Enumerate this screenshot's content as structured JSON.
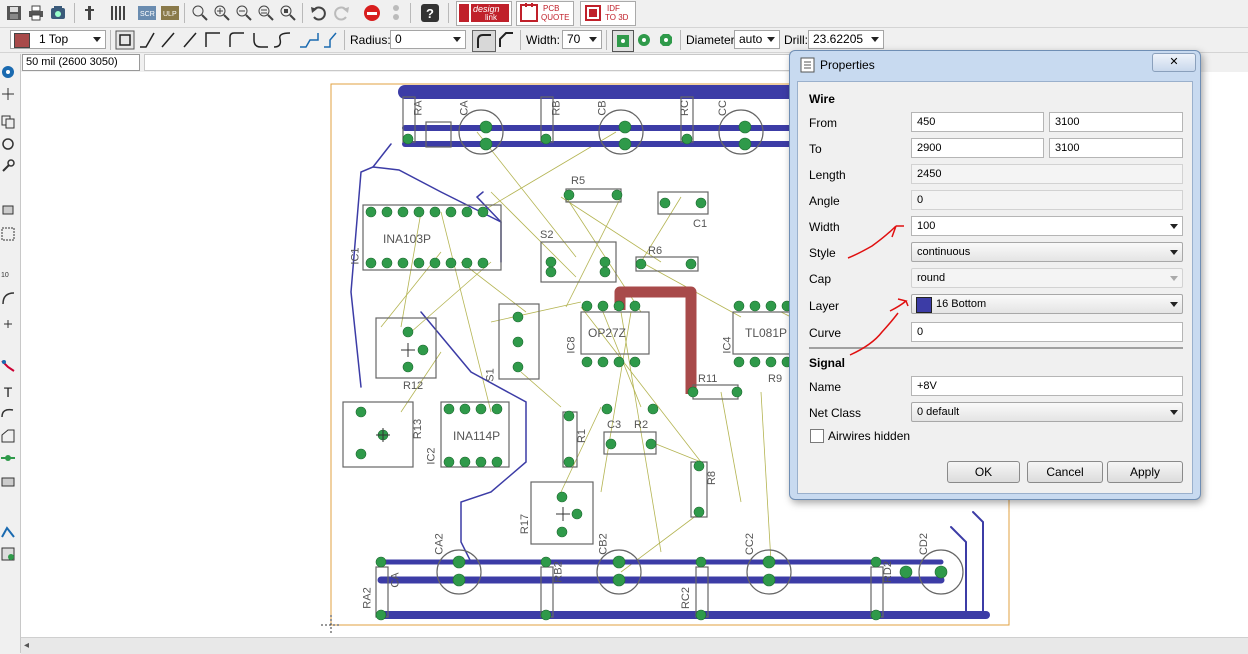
{
  "toolbar": {
    "layer_select": "1 Top",
    "radius_label": "Radius:",
    "radius_value": "0",
    "width_label": "Width:",
    "width_value": "70",
    "diameter_label": "Diameter:",
    "diameter_value": "auto",
    "drill_label": "Drill:",
    "drill_value": "23.62205",
    "design_link": [
      "design",
      "link"
    ],
    "pcb_quote": [
      "PCB",
      "QUOTE"
    ],
    "idf": [
      "IDF",
      "TO 3D"
    ]
  },
  "status": {
    "coordinates": "50 mil (2600 3050)"
  },
  "board": {
    "labels": [
      "RA",
      "CA",
      "RB",
      "CB",
      "RC",
      "CC",
      "R5",
      "C1",
      "INA103P",
      "IC1",
      "S2",
      "R6",
      "OP27Z",
      "IC8",
      "TL081P",
      "IC4",
      "R12",
      "S1",
      "R11",
      "R9",
      "R13",
      "IC2",
      "INA114P",
      "R1",
      "C3",
      "R2",
      "R8",
      "R17",
      "CA2",
      "CB2",
      "CC2",
      "CD2",
      "RA2",
      "RC2",
      "CA",
      "RB2",
      "RD2"
    ]
  },
  "dialog": {
    "title": "Properties",
    "close_glyph": "✕",
    "wire_section": "Wire",
    "from_label": "From",
    "from_x": "450",
    "from_y": "3100",
    "to_label": "To",
    "to_x": "2900",
    "to_y": "3100",
    "length_label": "Length",
    "length_value": "2450",
    "angle_label": "Angle",
    "angle_value": "0",
    "width_label": "Width",
    "width_value": "100",
    "style_label": "Style",
    "style_value": "continuous",
    "cap_label": "Cap",
    "cap_value": "round",
    "layer_label": "Layer",
    "layer_value": "16 Bottom",
    "curve_label": "Curve",
    "curve_value": "0",
    "signal_section": "Signal",
    "name_label": "Name",
    "name_value": "+8V",
    "netclass_label": "Net Class",
    "netclass_value": "0 default",
    "airwires_label": "Airwires hidden",
    "airwires_checked": false,
    "ok_label": "OK",
    "cancel_label": "Cancel",
    "apply_label": "Apply"
  },
  "colors": {
    "top_layer": "#a84a4a",
    "bottom_layer": "#3c3ca6",
    "pad": "#2f9a4a",
    "silkscreen": "#666666",
    "airwire": "#b4b452",
    "board_outline": "#e0a040",
    "annotation": "#e01010"
  }
}
